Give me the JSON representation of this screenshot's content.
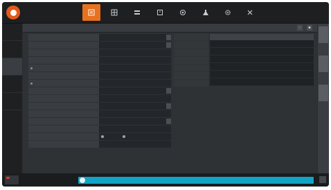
{
  "topbar": {
    "nav": [
      {
        "label": "",
        "icon": "list-icon",
        "active": true
      },
      {
        "label": "",
        "icon": "grid-icon",
        "active": false
      },
      {
        "label": "",
        "icon": "layers-icon",
        "active": false
      },
      {
        "label": "",
        "icon": "clock-icon",
        "active": false
      },
      {
        "label": "",
        "icon": "target-icon",
        "active": false
      },
      {
        "label": "",
        "icon": "flask-icon",
        "active": false
      },
      {
        "label": "",
        "icon": "gear-icon",
        "active": false
      },
      {
        "label": "",
        "icon": "tools-icon",
        "active": false
      }
    ],
    "right_text": ""
  },
  "sidebar": {
    "items": [
      {
        "label": "",
        "active": false
      },
      {
        "label": "",
        "active": false
      },
      {
        "label": "",
        "active": true
      },
      {
        "label": "",
        "active": false
      },
      {
        "label": "",
        "active": false
      }
    ]
  },
  "main": {
    "subheader_title": "",
    "settings_labels": [
      "",
      "",
      "",
      "",
      "",
      "",
      "",
      "",
      "",
      "",
      "",
      "",
      "",
      "",
      ""
    ],
    "settings_values": [
      "",
      "",
      "",
      "",
      "",
      "",
      "",
      "",
      "",
      "",
      "",
      "",
      "",
      "",
      ""
    ],
    "radio_options": [
      "",
      ""
    ],
    "info_labels": [
      "",
      "",
      "",
      "",
      "",
      "",
      ""
    ],
    "table": {
      "headers": [
        "",
        "",
        "",
        ""
      ],
      "rows": [
        [
          "",
          "",
          "",
          ""
        ],
        [
          "",
          "",
          "",
          ""
        ],
        [
          "",
          "",
          "",
          ""
        ],
        [
          "",
          "",
          "",
          ""
        ],
        [
          "",
          "",
          "",
          ""
        ],
        [
          "",
          "",
          "",
          ""
        ]
      ]
    }
  },
  "bottombar": {
    "info_text": "",
    "progress_text": ""
  },
  "colors": {
    "accent": "#e8711f",
    "progress": "#12a4c4",
    "ok": "#5fbf3a",
    "stop": "#d23a2a"
  }
}
